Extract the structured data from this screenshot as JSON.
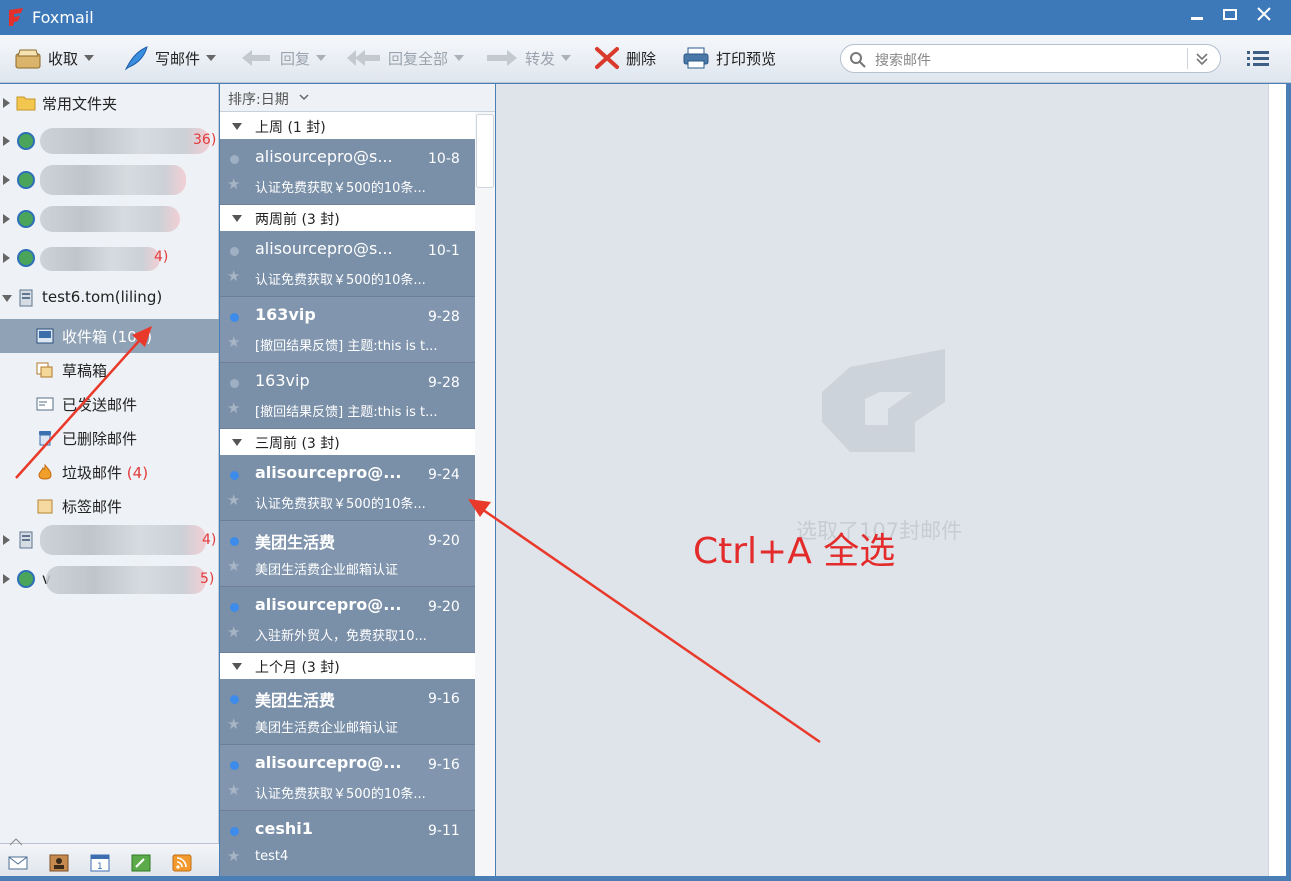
{
  "window": {
    "title": "Foxmail",
    "minimize": "—",
    "maximize": "□",
    "close": "✕"
  },
  "toolbar": {
    "receive": "收取",
    "compose": "写邮件",
    "reply": "回复",
    "reply_all": "回复全部",
    "forward": "转发",
    "delete": "删除",
    "print_preview": "打印预览",
    "search_placeholder": "搜索邮件"
  },
  "sidebar": {
    "common_folders": "常用文件夹",
    "accounts": [
      {
        "count": "36)"
      },
      {
        "count": ""
      },
      {
        "count": ""
      },
      {
        "count": "4)"
      }
    ],
    "account_name": "test6.tom(liling)",
    "folders": [
      {
        "label": "收件箱",
        "count": "(104)"
      },
      {
        "label": "草稿箱",
        "count": ""
      },
      {
        "label": "已发送邮件",
        "count": ""
      },
      {
        "label": "已删除邮件",
        "count": ""
      },
      {
        "label": "垃圾邮件",
        "count": "(4)"
      },
      {
        "label": "标签邮件",
        "count": ""
      }
    ],
    "more_accounts": [
      {
        "count": "4)"
      },
      {
        "prefix": "v",
        "count": "5)"
      }
    ]
  },
  "maillist": {
    "sort_label": "排序:日期",
    "groups": [
      {
        "label": "上周 (1 封)"
      },
      {
        "label": "两周前 (3 封)"
      },
      {
        "label": "三周前 (3 封)"
      },
      {
        "label": "上个月 (3 封)"
      }
    ],
    "mails": [
      {
        "from": "alisourcepro@s...",
        "date": "10-8",
        "subject": "认证免费获取￥500的10条...",
        "unread": false
      },
      {
        "from": "alisourcepro@s...",
        "date": "10-1",
        "subject": "认证免费获取￥500的10条...",
        "unread": false
      },
      {
        "from": "163vip",
        "date": "9-28",
        "subject": "[撤回结果反馈] 主题:this is t...",
        "unread": true
      },
      {
        "from": "163vip",
        "date": "9-28",
        "subject": "[撤回结果反馈] 主题:this is t...",
        "unread": false
      },
      {
        "from": "alisourcepro@...",
        "date": "9-24",
        "subject": "认证免费获取￥500的10条...",
        "unread": true
      },
      {
        "from": "美团生活费",
        "date": "9-20",
        "subject": "美团生活费企业邮箱认证",
        "unread": true
      },
      {
        "from": "alisourcepro@...",
        "date": "9-20",
        "subject": "入驻新外贸人，免费获取10...",
        "unread": true
      },
      {
        "from": "美团生活费",
        "date": "9-16",
        "subject": "美团生活费企业邮箱认证",
        "unread": true
      },
      {
        "from": "alisourcepro@...",
        "date": "9-16",
        "subject": "认证免费获取￥500的10条...",
        "unread": true
      },
      {
        "from": "ceshi1",
        "date": "9-11",
        "subject": "test4",
        "unread": true
      }
    ]
  },
  "preview": {
    "selected_text": "选取了107封邮件"
  },
  "annotation": {
    "text": "Ctrl+A 全选",
    "color": "#e32b2b"
  }
}
